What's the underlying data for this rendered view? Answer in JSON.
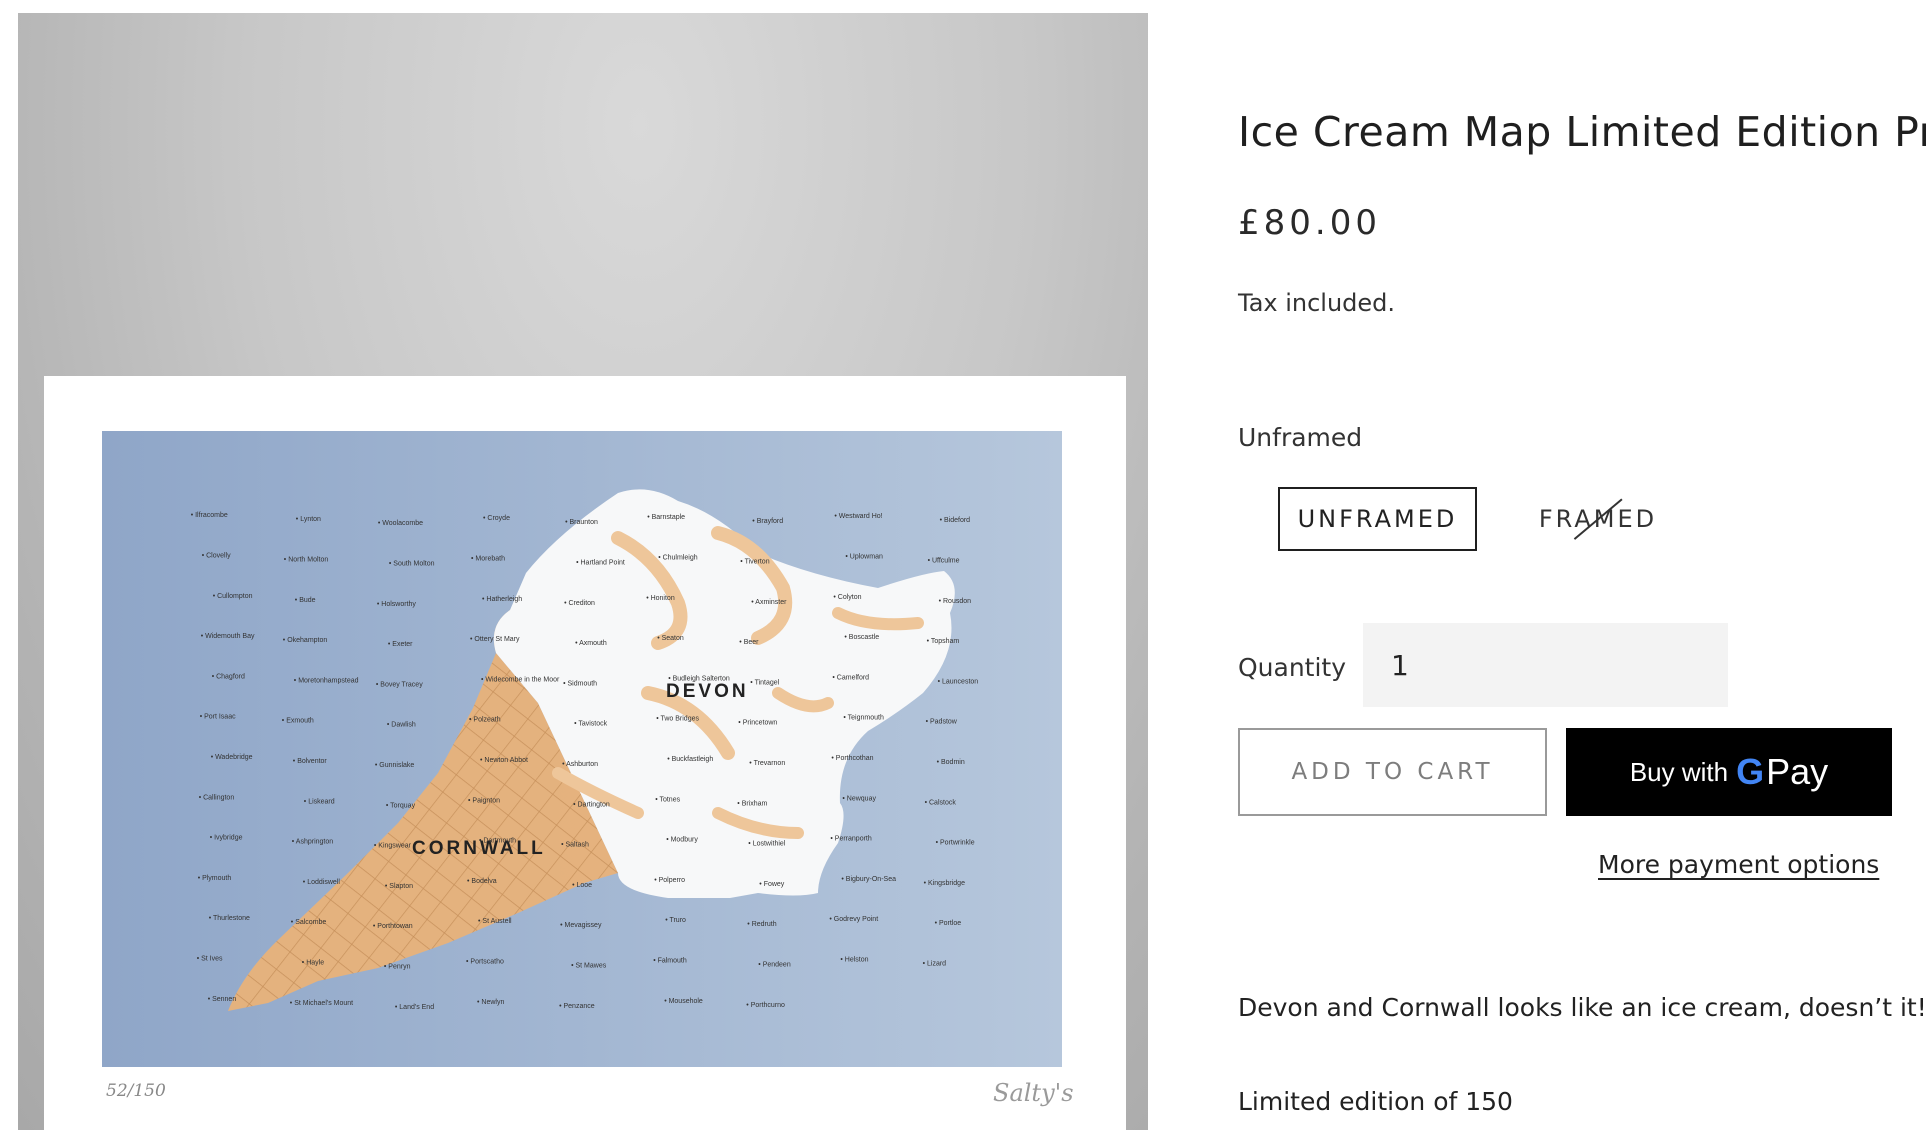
{
  "product": {
    "title": "Ice Cream Map Limited Edition Print",
    "price": "£80.00",
    "tax_note": "Tax included.",
    "variant_label": "Unframed",
    "variants": [
      {
        "label": "UNFRAMED",
        "selected": true,
        "available": true
      },
      {
        "label": "FRAMED",
        "selected": false,
        "available": false
      }
    ],
    "quantity_label": "Quantity",
    "quantity_value": "1",
    "add_to_cart": "ADD TO CART",
    "gpay": {
      "prefix": "Buy with",
      "g": "G",
      "pay": "Pay"
    },
    "more_payment": "More payment options",
    "description": "Devon and Cornwall looks like an ice cream, doesn’t it!?",
    "edition_note": "Limited edition of 150"
  },
  "print_image": {
    "map_labels": {
      "devon": "DEVON",
      "cornwall": "CORNWALL",
      "places": [
        "Ilfracombe",
        "Lynton",
        "Woolacombe",
        "Croyde",
        "Braunton",
        "Barnstaple",
        "Brayford",
        "Westward Ho!",
        "Bideford",
        "Clovelly",
        "North Molton",
        "South Molton",
        "Morebath",
        "Hartland Point",
        "Chulmleigh",
        "Tiverton",
        "Uplowman",
        "Uffculme",
        "Cullompton",
        "Bude",
        "Holsworthy",
        "Hatherleigh",
        "Crediton",
        "Honiton",
        "Axminster",
        "Colyton",
        "Rousdon",
        "Widemouth Bay",
        "Okehampton",
        "Exeter",
        "Ottery St Mary",
        "Axmouth",
        "Seaton",
        "Beer",
        "Boscastle",
        "Topsham",
        "Chagford",
        "Moretonhampstead",
        "Bovey Tracey",
        "Widecombe in the Moor",
        "Sidmouth",
        "Budleigh Salterton",
        "Tintagel",
        "Camelford",
        "Launceston",
        "Port Isaac",
        "Exmouth",
        "Dawlish",
        "Polzeath",
        "Tavistock",
        "Two Bridges",
        "Princetown",
        "Teignmouth",
        "Padstow",
        "Wadebridge",
        "Bolventor",
        "Gunnislake",
        "Newton Abbot",
        "Ashburton",
        "Buckfastleigh",
        "Trevarnon",
        "Porthcothan",
        "Bodmin",
        "Callington",
        "Liskeard",
        "Torquay",
        "Paignton",
        "Dartington",
        "Totnes",
        "Brixham",
        "Newquay",
        "Calstock",
        "Ivybridge",
        "Ashprington",
        "Kingswear",
        "Dartmouth",
        "Saltash",
        "Modbury",
        "Lostwithiel",
        "Perranporth",
        "Portwrinkle",
        "Plymouth",
        "Loddiswell",
        "Slapton",
        "Bodelva",
        "Looe",
        "Polperro",
        "Fowey",
        "Bigbury-On-Sea",
        "Kingsbridge",
        "Thurlestone",
        "Salcombe",
        "Porthtowan",
        "St Austell",
        "Mevagissey",
        "Truro",
        "Redruth",
        "Godrevy Point",
        "Portloe",
        "St Ives",
        "Hayle",
        "Penryn",
        "Portscatho",
        "St Mawes",
        "Falmouth",
        "Pendeen",
        "Helston",
        "Lizard",
        "Sennen",
        "St Michael's Mount",
        "Land's End",
        "Newlyn",
        "Penzance",
        "Mousehole",
        "Porthcurno"
      ]
    },
    "edition_number": "52/150",
    "signature": "Salty's"
  }
}
